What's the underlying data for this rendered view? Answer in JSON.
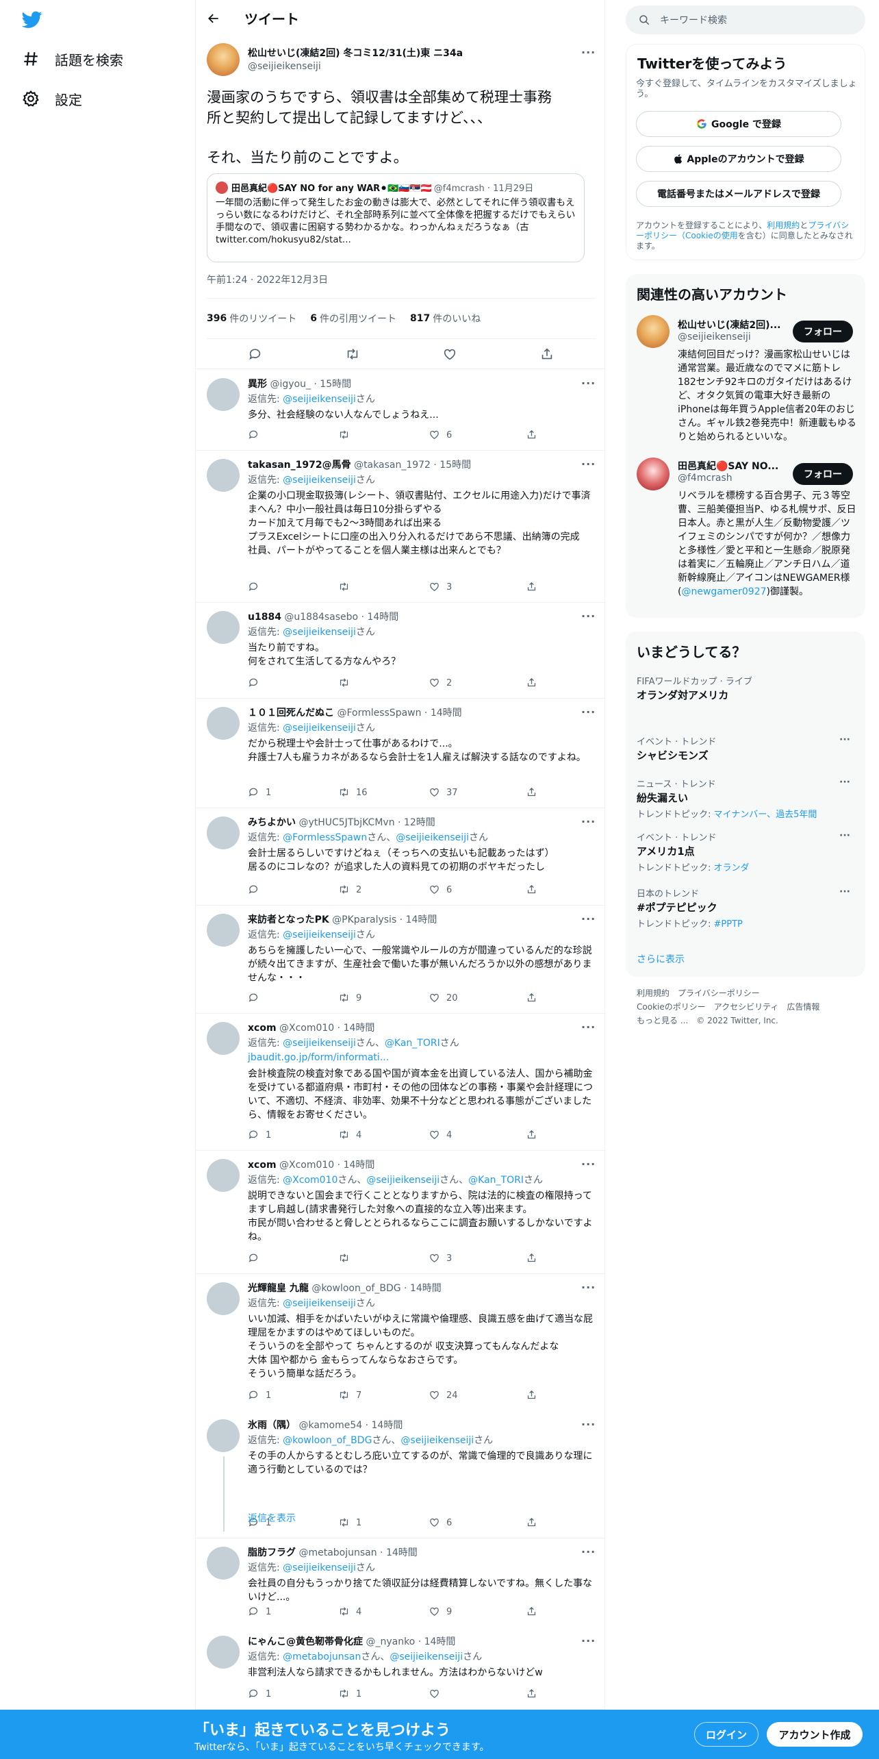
{
  "nav": {
    "explore_label": "話題を検索",
    "settings_label": "設定"
  },
  "header": {
    "title": "ツイート"
  },
  "main_tweet": {
    "name": "松山せいじ(凍結2回) 冬コミ12/31(土)東 ニ34a",
    "handle": "@seijieikenseiji",
    "text_line1": "漫画家のうちですら、領収書は全部集めて税理士事務",
    "text_line2": "所と契約して提出して記録してますけど、、、",
    "text_line3": "それ、当たり前のことですよ。",
    "quote": {
      "name": "田邑真紀🔴SAY NO for any WAR⚫🇧🇷🇸🇮🇷🇸🇦🇹",
      "meta": "@f4mcrash · 11月29日",
      "body": "一年間の活動に伴って発生したお金の動きは膨大で、必然としてそれに伴う領収書もえっらい数になるわけだけど、それ全部時系列に並べて全体像を把握するだけでもえらい手間なので、領収書に困窮する勢わかるかな。わっかんねぇだろうなぁ（古 twitter.com/hokusyu82/stat..."
    },
    "date": "午前1:24 · 2022年12月3日",
    "retweets": "396",
    "retweets_label": "件のリツイート",
    "quotes": "6",
    "quotes_label": "件の引用ツイート",
    "likes": "817",
    "likes_label": "件のいいね"
  },
  "replying_to": "返信先: ",
  "replies": [
    {
      "name": "異形",
      "meta": "@igyou_ · 15時間",
      "to": "@seijieikenseiji",
      "to_suffix": "さん",
      "body": "多分、社会経験のない人なんでしょうねえ...",
      "reply": "",
      "rt": "",
      "like": "6"
    },
    {
      "name": "takasan_1972@馬骨",
      "meta": "@takasan_1972 · 15時間",
      "to": "@seijieikenseiji",
      "to_suffix": "さん",
      "body": "企業の小口現金取扱簿(レシート、領収書貼付、エクセルに用途入力)だけで事済まへん？中小一般社員は毎日10分掛らずやる\nカード加えて月毎でも2～3時間あれば出来る\nプラスExcelシートに口座の出入り分入れるだけであら不思議、出納簿の完成\n社員、パートがやってることを個人業主様は出来んとでも？",
      "reply": "",
      "rt": "",
      "like": "3"
    },
    {
      "name": "u1884",
      "meta": "@u1884sasebo · 14時間",
      "to": "@seijieikenseiji",
      "to_suffix": "さん",
      "body": "当たり前ですね。\n何をされて生活してる方なんやろ？",
      "reply": "",
      "rt": "",
      "like": "2"
    },
    {
      "name": "１０１回死んだぬこ",
      "meta": "@FormlessSpawn · 14時間",
      "to": "@seijieikenseiji",
      "to_suffix": "さん",
      "body": "だから税理士や会計士って仕事があるわけで...。\n弁護士7人も雇うカネがあるなら会計士を1人雇えば解決する話なのですよね。",
      "reply": "1",
      "rt": "16",
      "like": "37"
    },
    {
      "name": "みちよかい",
      "meta": "@ytHUC5JTbjKCMvn · 12時間",
      "to": "@FormlessSpawn",
      "to_suffix": "さん、",
      "to2": "@seijieikenseiji",
      "to2_suffix": "さん",
      "body": "会計士居るらしいですけどねぇ（そっちへの支払いも記載あったはず）\n居るのにコレなの？が追求した人の資料見ての初期のボヤキだったし",
      "reply": "",
      "rt": "2",
      "like": "6"
    },
    {
      "name": "来訪者となったPK",
      "meta": "@PKparalysis · 14時間",
      "to": "@seijieikenseiji",
      "to_suffix": "さん",
      "body": "あちらを擁護したい一心で、一般常識やルールの方が間違っているんだ的な珍説が続々出てきますが、生産社会で働いた事が無いんだろうか以外の感想がありませんな・・・",
      "reply": "",
      "rt": "9",
      "like": "20"
    },
    {
      "name": "xcom",
      "meta": "@Xcom010 · 14時間",
      "to": "@seijieikenseiji",
      "to_suffix": "さん、",
      "to2": "@Kan_TORI",
      "to2_suffix": "さん",
      "link": "jbaudit.go.jp/form/informati...",
      "body": "会計検査院の検査対象である国や国が資本金を出資している法人、国から補助金を受けている都道府県・市町村・その他の団体などの事務・事業や会計経理について、不適切、不経済、非効率、効果不十分などと思われる事態がございましたら、情報をお寄せください。",
      "reply": "1",
      "rt": "4",
      "like": "4"
    },
    {
      "name": "xcom",
      "meta": "@Xcom010 · 14時間",
      "to": "@Xcom010",
      "to_suffix": "さん、",
      "to2": "@seijieikenseiji",
      "to2_suffix": "さん、",
      "to3": "@Kan_TORI",
      "to3_suffix": "さん",
      "body": "説明できないと国会まで行くこととなりますから、院は法的に検査の権限持ってますし肩越し(請求書発行した対象への直接的な立入等)出来ます。\n市民が問い合わせると脅しととられるならここに調査お願いするしかないですよね。",
      "reply": "",
      "rt": "",
      "like": "3"
    },
    {
      "name": "光輝龍皇 九龍",
      "meta": "@kowloon_of_BDG · 14時間",
      "to": "@seijieikenseiji",
      "to_suffix": "さん",
      "body": "いい加減、相手をかばいたいがゆえに常識や倫理感、良識五感を曲げて適当な屁理屈をかますのはやめてほしいものだ。\nそういうのを全部やって ちゃんとするのが 収支決算ってもんなんだよな\n大体 国や都から 金もらってんならなおさらです。\nそういう簡単な話だろう。",
      "reply": "1",
      "rt": "7",
      "like": "24"
    },
    {
      "name": "氷雨（隅）",
      "meta": "@kamome54 · 14時間",
      "to": "@kowloon_of_BDG",
      "to_suffix": "さん、",
      "to2": "@seijieikenseiji",
      "to2_suffix": "さん",
      "body": "その手の人からするとむしろ庇い立てするのが、常識で倫理的で良識ありな理に適う行動としているのでは？",
      "reply": "1",
      "rt": "1",
      "like": "6"
    },
    {
      "name": "脂肪フラグ",
      "meta": "@metabojunsan · 14時間",
      "to": "@seijieikenseiji",
      "to_suffix": "さん",
      "body": "会社員の自分もうっかり捨てた領収証分は経費精算しないですね。無くした事ないけど...。",
      "reply": "1",
      "rt": "4",
      "like": "9"
    },
    {
      "name": "にゃんこ@黄色靭帯骨化症",
      "meta": "@_nyanko · 14時間",
      "to": "@metabojunsan",
      "to_suffix": "さん、",
      "to2": "@seijieikenseiji",
      "to2_suffix": "さん",
      "body": "非営利法人なら請求できるかもしれません。方法はわからないけどw",
      "reply": "1",
      "rt": "1",
      "like": ""
    }
  ],
  "show_replies": "返信を表示",
  "right": {
    "search_placeholder": "キーワード検索",
    "signup_title": "Twitterを使ってみよう",
    "signup_sub": "今すぐ登録して、タイムラインをカスタマイズしましょう。",
    "google_btn": "Google で登録",
    "apple_btn": "Appleのアカウントで登録",
    "phone_btn": "電話番号またはメールアドレスで登録",
    "terms_1": "アカウントを登録することにより、",
    "terms_link1": "利用規約",
    "terms_2": "と",
    "terms_link2": "プライバシーポリシー（Cookieの使用",
    "terms_3": "を含む）に同意したとみなされます。",
    "related_title": "関連性の高いアカウント",
    "accounts": [
      {
        "name": "松山せいじ(凍結2回)...",
        "handle": "@seijieikenseiji",
        "bio": "凍結何回目だっけ？漫画家松山せいじは通常営業。最近歳なのでマメに筋トレ182センチ92キロのガタイだけはあるけど、オタク気質の電車大好き最新のiPhoneは毎年買うApple信者20年のおじさん。ギャル鉄2巻発売中！新連載もゆるりと始められるといいな。",
        "follow": "フォロー"
      },
      {
        "name": "田邑真紀🔴SAY NO...",
        "handle": "@f4mcrash",
        "bio": "リベラルを標榜する百合男子、元３等空曹、三船美優担当P、ゆる札幌サポ、反日日本人。赤と黒が人生／反動物愛護／ツイフェミのシンパですが何か？／想像力と多様性／愛と平和と一生懸命／脱原発は着実に／五輪廃止／アンチ日ハム／道新幹線廃止／アイコンはNEWGAMER様(",
        "bio_link": "@newgamer0927",
        "bio_end": ")御謹製。",
        "follow": "フォロー"
      }
    ],
    "trends_title": "いまどうしてる？",
    "trends": [
      {
        "meta": "FIFAワールドカップ · ライブ",
        "title": "オランダ対アメリカ",
        "sub": "",
        "sub_link": "",
        "more": false
      },
      {
        "meta": "イベント · トレンド",
        "title": "シャビシモンズ",
        "sub": "",
        "sub_link": "",
        "more": true
      },
      {
        "meta": "ニュース · トレンド",
        "title": "紛失漏えい",
        "sub": "トレンドトピック: ",
        "sub_link": "マイナンバー、過去5年間",
        "more": true
      },
      {
        "meta": "イベント · トレンド",
        "title": "アメリカ1点",
        "sub": "トレンドトピック: ",
        "sub_link": "オランダ",
        "more": true
      },
      {
        "meta": "日本のトレンド",
        "title": "#ポプテピピック",
        "sub": "トレンドトピック: ",
        "sub_link": "#PPTP",
        "more": true
      }
    ],
    "show_more": "さらに表示",
    "footer_line1": "利用規約　プライバシーポリシー",
    "footer_line2": "Cookieのポリシー　アクセシビリティ　広告情報",
    "footer_line3": "もっと見る ...　© 2022 Twitter, Inc."
  },
  "bottombar": {
    "title": "「いま」起きていることを見つけよう",
    "sub": "Twitterなら、「いま」起きていることをいち早くチェックできます。",
    "login": "ログイン",
    "signup": "アカウント作成"
  },
  "colors": {
    "brand": "#1d9bf0",
    "text": "#0f1419",
    "muted": "#536471"
  }
}
